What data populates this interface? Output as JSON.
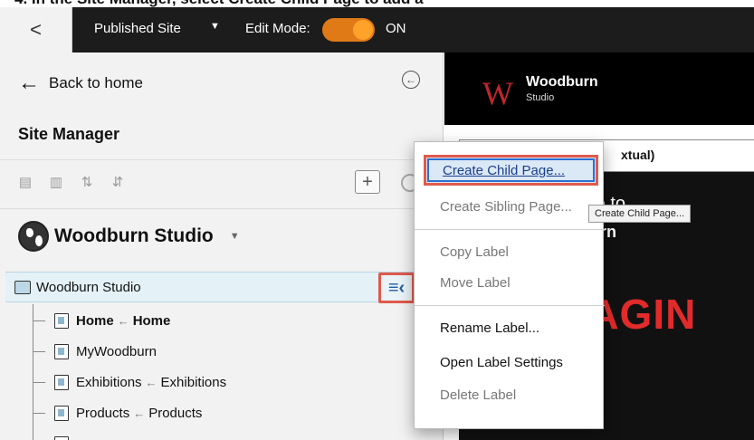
{
  "caption": "4. In the Site Manager, select Create Child Page to add a",
  "topbar": {
    "back_glyph": "<",
    "published_site": "Published Site",
    "edit_mode_label": "Edit Mode:",
    "toggle_state": "ON",
    "toggle_color": "#e07a17"
  },
  "panel": {
    "back_home": "Back to home",
    "title": "Site Manager",
    "tool_icons": [
      "page-layout-icon",
      "page-edit-icon",
      "move-up-icon",
      "move-down-icon"
    ],
    "site_name": "Woodburn Studio"
  },
  "tree": {
    "root": "Woodburn Studio",
    "items": [
      {
        "label": "Home",
        "alias": "Home",
        "bold": true
      },
      {
        "label": "MyWoodburn",
        "alias": "",
        "bold": false
      },
      {
        "label": "Exhibitions",
        "alias": "Exhibitions",
        "bold": false
      },
      {
        "label": "Products",
        "alias": "Products",
        "bold": false
      }
    ],
    "alias_arrow": "←"
  },
  "preview": {
    "logo_letter": "W",
    "brand_name": "Woodburn",
    "brand_sub": "Studio",
    "bar_text": "xtual)",
    "welcome_line1": "me to",
    "welcome_line2": "burn",
    "hero_text": "MAGIN"
  },
  "context_menu": {
    "items": [
      {
        "label": "Create Child Page...",
        "disabled": false,
        "highlight": true
      },
      {
        "label": "Create Sibling Page...",
        "disabled": true,
        "highlight": false
      },
      {
        "label": "Copy Label",
        "disabled": true,
        "highlight": false
      },
      {
        "label": "Move Label",
        "disabled": true,
        "highlight": false
      },
      {
        "label": "Rename Label...",
        "disabled": false,
        "highlight": false
      },
      {
        "label": "Open Label Settings",
        "disabled": false,
        "highlight": false
      },
      {
        "label": "Delete Label",
        "disabled": true,
        "highlight": false
      }
    ],
    "tooltip": "Create Child Page..."
  },
  "colors": {
    "highlight_border": "#e05a4c",
    "selection_bg": "#e4f1f6",
    "brand_red": "#c0262d"
  }
}
